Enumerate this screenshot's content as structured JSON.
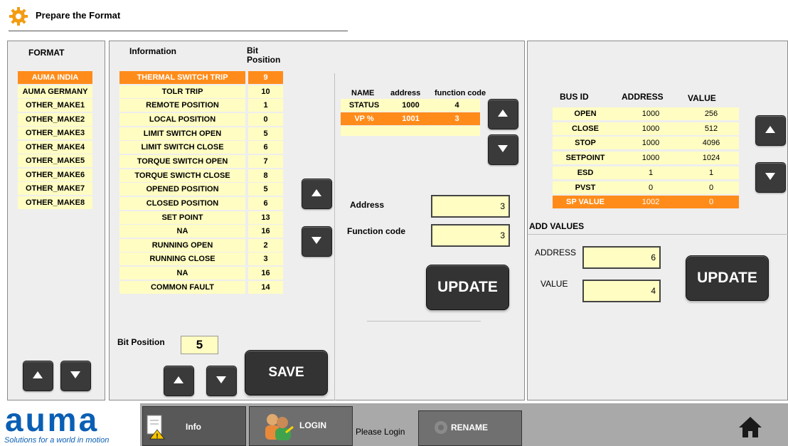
{
  "title": "Prepare the Format",
  "format_panel": {
    "header": "FORMAT",
    "items": [
      "AUMA INDIA",
      "AUMA GERMANY",
      "OTHER_MAKE1",
      "OTHER_MAKE2",
      "OTHER_MAKE3",
      "OTHER_MAKE4",
      "OTHER_MAKE5",
      "OTHER_MAKE6",
      "OTHER_MAKE7",
      "OTHER_MAKE8"
    ],
    "selected_index": 0
  },
  "info_panel": {
    "header_info": "Information",
    "header_bit": "Bit Position",
    "rows": [
      {
        "info": "THERMAL SWITCH TRIP",
        "bit": "9"
      },
      {
        "info": "TOLR TRIP",
        "bit": "10"
      },
      {
        "info": "REMOTE POSITION",
        "bit": "1"
      },
      {
        "info": "LOCAL POSITION",
        "bit": "0"
      },
      {
        "info": "LIMIT SWITCH OPEN",
        "bit": "5"
      },
      {
        "info": "LIMIT SWITCH CLOSE",
        "bit": "6"
      },
      {
        "info": "TORQUE SWITCH OPEN",
        "bit": "7"
      },
      {
        "info": "TORQUE SWICTH CLOSE",
        "bit": "8"
      },
      {
        "info": "OPENED POSITION",
        "bit": "5"
      },
      {
        "info": "CLOSED POSITION",
        "bit": "6"
      },
      {
        "info": "SET POINT",
        "bit": "13"
      },
      {
        "info": "NA",
        "bit": "16"
      },
      {
        "info": "RUNNING OPEN",
        "bit": "2"
      },
      {
        "info": "RUNNING CLOSE",
        "bit": "3"
      },
      {
        "info": "NA",
        "bit": "16"
      },
      {
        "info": "COMMON FAULT",
        "bit": "14"
      }
    ],
    "selected_index": 0,
    "bit_position_label": "Bit Position",
    "bit_position_value": "5",
    "save_label": "SAVE"
  },
  "name_panel": {
    "headers": {
      "name": "NAME",
      "address": "address",
      "function_code": "function code"
    },
    "rows": [
      {
        "name": "STATUS",
        "address": "1000",
        "function_code": "4"
      },
      {
        "name": "VP %",
        "address": "1001",
        "function_code": "3"
      }
    ],
    "selected_index": 1,
    "address_label": "Address",
    "address_value": "3",
    "function_code_label": "Function code",
    "function_code_value": "3",
    "update_label": "UPDATE"
  },
  "bus_panel": {
    "headers": {
      "bus_id": "BUS ID",
      "address": "ADDRESS",
      "value": "VALUE"
    },
    "rows": [
      {
        "bus_id": "OPEN",
        "address": "1000",
        "value": "256"
      },
      {
        "bus_id": "CLOSE",
        "address": "1000",
        "value": "512"
      },
      {
        "bus_id": "STOP",
        "address": "1000",
        "value": "4096"
      },
      {
        "bus_id": "SETPOINT",
        "address": "1000",
        "value": "1024"
      },
      {
        "bus_id": "ESD",
        "address": "1",
        "value": "1"
      },
      {
        "bus_id": "PVST",
        "address": "0",
        "value": "0"
      },
      {
        "bus_id": "SP VALUE",
        "address": "1002",
        "value": "0"
      }
    ],
    "selected_index": 6,
    "add_values_label": "ADD VALUES",
    "address_label": "ADDRESS",
    "address_value": "6",
    "value_label": "VALUE",
    "value_value": "4",
    "update_label": "UPDATE"
  },
  "footer": {
    "logo": "auma",
    "tagline": "Solutions for a world in motion",
    "info_label": "Info",
    "login_label": "LOGIN",
    "status_text": "Please Login",
    "rename_label": "RENAME",
    "home_icon": "home-icon"
  },
  "colors": {
    "selected": "#ff8c1a",
    "cell": "#fffdc2",
    "button": "#333333",
    "logo": "#0a5fb4"
  }
}
